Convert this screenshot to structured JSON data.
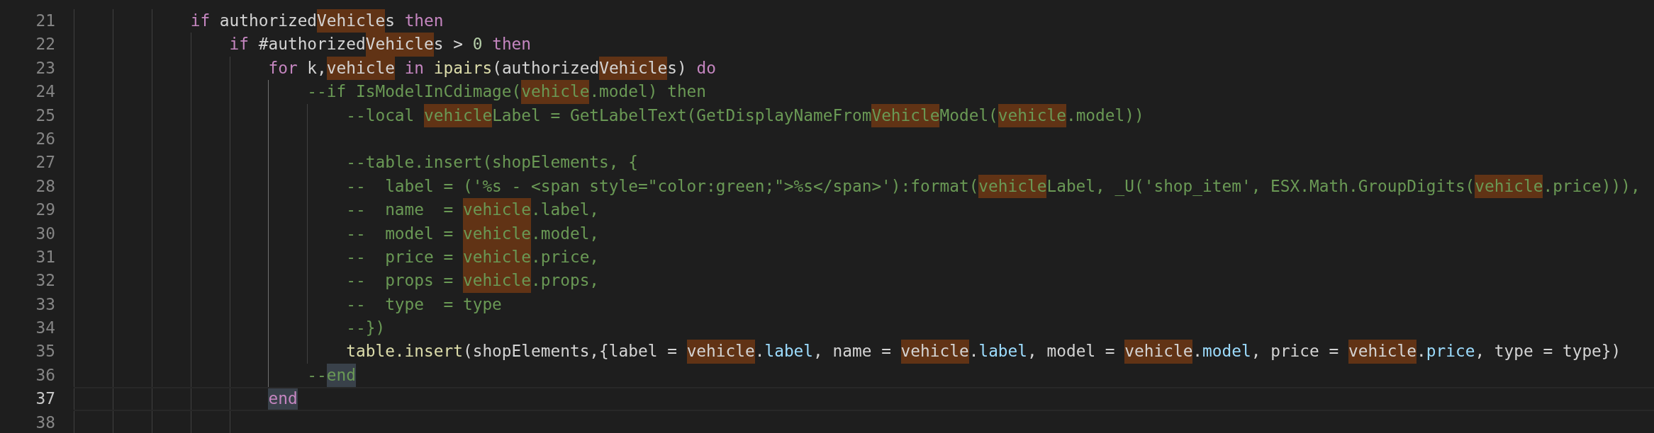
{
  "editor": {
    "lines": [
      {
        "number": "21",
        "current": false,
        "guides": [
          {
            "active": false
          },
          {
            "active": false
          },
          {
            "active": false
          }
        ],
        "tokens": [
          {
            "text": "if",
            "kind": "keyword",
            "match": false,
            "bracket_match": false
          },
          {
            "text": " authorized",
            "kind": "plain",
            "match": false,
            "bracket_match": false
          },
          {
            "text": "Vehicle",
            "kind": "plain",
            "match": true,
            "bracket_match": false
          },
          {
            "text": "s",
            "kind": "plain",
            "match": false,
            "bracket_match": false
          },
          {
            "text": " then",
            "kind": "keyword",
            "match": false,
            "bracket_match": false
          }
        ]
      },
      {
        "number": "22",
        "current": false,
        "guides": [
          {
            "active": false
          },
          {
            "active": false
          },
          {
            "active": false
          },
          {
            "active": false
          }
        ],
        "tokens": [
          {
            "text": "if",
            "kind": "keyword",
            "match": false,
            "bracket_match": false
          },
          {
            "text": " #authorized",
            "kind": "plain",
            "match": false,
            "bracket_match": false
          },
          {
            "text": "Vehicle",
            "kind": "plain",
            "match": true,
            "bracket_match": false
          },
          {
            "text": "s >",
            "kind": "plain",
            "match": false,
            "bracket_match": false
          },
          {
            "text": " 0",
            "kind": "number",
            "match": false,
            "bracket_match": false
          },
          {
            "text": " then",
            "kind": "keyword",
            "match": false,
            "bracket_match": false
          }
        ]
      },
      {
        "number": "23",
        "current": false,
        "guides": [
          {
            "active": false
          },
          {
            "active": false
          },
          {
            "active": false
          },
          {
            "active": false
          },
          {
            "active": false
          }
        ],
        "tokens": [
          {
            "text": "for",
            "kind": "keyword",
            "match": false,
            "bracket_match": false
          },
          {
            "text": " k,",
            "kind": "plain",
            "match": false,
            "bracket_match": false
          },
          {
            "text": "vehicle",
            "kind": "plain",
            "match": true,
            "bracket_match": false
          },
          {
            "text": " in",
            "kind": "keyword",
            "match": false,
            "bracket_match": false
          },
          {
            "text": " ipairs",
            "kind": "function",
            "match": false,
            "bracket_match": false
          },
          {
            "text": "(authorized",
            "kind": "plain",
            "match": false,
            "bracket_match": false
          },
          {
            "text": "Vehicle",
            "kind": "plain",
            "match": true,
            "bracket_match": false
          },
          {
            "text": "s)",
            "kind": "plain",
            "match": false,
            "bracket_match": false
          },
          {
            "text": " do",
            "kind": "keyword",
            "match": false,
            "bracket_match": false
          }
        ]
      },
      {
        "number": "24",
        "current": false,
        "guides": [
          {
            "active": false
          },
          {
            "active": false
          },
          {
            "active": false
          },
          {
            "active": false
          },
          {
            "active": false
          },
          {
            "active": true
          }
        ],
        "tokens": [
          {
            "text": "--if IsModelInCdimage(",
            "kind": "comment",
            "match": false,
            "bracket_match": false
          },
          {
            "text": "vehicle",
            "kind": "comment",
            "match": true,
            "bracket_match": false
          },
          {
            "text": ".model) then",
            "kind": "comment",
            "match": false,
            "bracket_match": false
          }
        ]
      },
      {
        "number": "25",
        "current": false,
        "guides": [
          {
            "active": false
          },
          {
            "active": false
          },
          {
            "active": false
          },
          {
            "active": false
          },
          {
            "active": false
          },
          {
            "active": true
          },
          {
            "active": false
          }
        ],
        "tokens": [
          {
            "text": "--local ",
            "kind": "comment",
            "match": false,
            "bracket_match": false
          },
          {
            "text": "vehicle",
            "kind": "comment",
            "match": true,
            "bracket_match": false
          },
          {
            "text": "Label = GetLabelText(GetDisplayNameFrom",
            "kind": "comment",
            "match": false,
            "bracket_match": false
          },
          {
            "text": "Vehicle",
            "kind": "comment",
            "match": true,
            "bracket_match": false
          },
          {
            "text": "Model(",
            "kind": "comment",
            "match": false,
            "bracket_match": false
          },
          {
            "text": "vehicle",
            "kind": "comment",
            "match": true,
            "bracket_match": false
          },
          {
            "text": ".model))",
            "kind": "comment",
            "match": false,
            "bracket_match": false
          }
        ]
      },
      {
        "number": "26",
        "current": false,
        "guides": [
          {
            "active": false
          },
          {
            "active": false
          },
          {
            "active": false
          },
          {
            "active": false
          },
          {
            "active": false
          },
          {
            "active": true
          },
          {
            "active": false
          }
        ]
      },
      {
        "number": "27",
        "current": false,
        "guides": [
          {
            "active": false
          },
          {
            "active": false
          },
          {
            "active": false
          },
          {
            "active": false
          },
          {
            "active": false
          },
          {
            "active": true
          },
          {
            "active": false
          }
        ],
        "tokens": [
          {
            "text": "--table.insert(shopElements, {",
            "kind": "comment",
            "match": false,
            "bracket_match": false
          }
        ]
      },
      {
        "number": "28",
        "current": false,
        "guides": [
          {
            "active": false
          },
          {
            "active": false
          },
          {
            "active": false
          },
          {
            "active": false
          },
          {
            "active": false
          },
          {
            "active": true
          },
          {
            "active": false
          }
        ],
        "tokens": [
          {
            "text": "--  label = ('%s - <span style=\"color:green;\">%s</span>'):format(",
            "kind": "comment",
            "match": false,
            "bracket_match": false
          },
          {
            "text": "vehicle",
            "kind": "comment",
            "match": true,
            "bracket_match": false
          },
          {
            "text": "Label, _U('shop_item', ESX.Math.GroupDigits(",
            "kind": "comment",
            "match": false,
            "bracket_match": false
          },
          {
            "text": "vehicle",
            "kind": "comment",
            "match": true,
            "bracket_match": false
          },
          {
            "text": ".price))),",
            "kind": "comment",
            "match": false,
            "bracket_match": false
          }
        ]
      },
      {
        "number": "29",
        "current": false,
        "guides": [
          {
            "active": false
          },
          {
            "active": false
          },
          {
            "active": false
          },
          {
            "active": false
          },
          {
            "active": false
          },
          {
            "active": true
          },
          {
            "active": false
          }
        ],
        "tokens": [
          {
            "text": "--  name  = ",
            "kind": "comment",
            "match": false,
            "bracket_match": false
          },
          {
            "text": "vehicle",
            "kind": "comment",
            "match": true,
            "bracket_match": false
          },
          {
            "text": ".label,",
            "kind": "comment",
            "match": false,
            "bracket_match": false
          }
        ]
      },
      {
        "number": "30",
        "current": false,
        "guides": [
          {
            "active": false
          },
          {
            "active": false
          },
          {
            "active": false
          },
          {
            "active": false
          },
          {
            "active": false
          },
          {
            "active": true
          },
          {
            "active": false
          }
        ],
        "tokens": [
          {
            "text": "--  model = ",
            "kind": "comment",
            "match": false,
            "bracket_match": false
          },
          {
            "text": "vehicle",
            "kind": "comment",
            "match": true,
            "bracket_match": false
          },
          {
            "text": ".model,",
            "kind": "comment",
            "match": false,
            "bracket_match": false
          }
        ]
      },
      {
        "number": "31",
        "current": false,
        "guides": [
          {
            "active": false
          },
          {
            "active": false
          },
          {
            "active": false
          },
          {
            "active": false
          },
          {
            "active": false
          },
          {
            "active": true
          },
          {
            "active": false
          }
        ],
        "tokens": [
          {
            "text": "--  price = ",
            "kind": "comment",
            "match": false,
            "bracket_match": false
          },
          {
            "text": "vehicle",
            "kind": "comment",
            "match": true,
            "bracket_match": false
          },
          {
            "text": ".price,",
            "kind": "comment",
            "match": false,
            "bracket_match": false
          }
        ]
      },
      {
        "number": "32",
        "current": false,
        "guides": [
          {
            "active": false
          },
          {
            "active": false
          },
          {
            "active": false
          },
          {
            "active": false
          },
          {
            "active": false
          },
          {
            "active": true
          },
          {
            "active": false
          }
        ],
        "tokens": [
          {
            "text": "--  props = ",
            "kind": "comment",
            "match": false,
            "bracket_match": false
          },
          {
            "text": "vehicle",
            "kind": "comment",
            "match": true,
            "bracket_match": false
          },
          {
            "text": ".props,",
            "kind": "comment",
            "match": false,
            "bracket_match": false
          }
        ]
      },
      {
        "number": "33",
        "current": false,
        "guides": [
          {
            "active": false
          },
          {
            "active": false
          },
          {
            "active": false
          },
          {
            "active": false
          },
          {
            "active": false
          },
          {
            "active": true
          },
          {
            "active": false
          }
        ],
        "tokens": [
          {
            "text": "--  type  = type",
            "kind": "comment",
            "match": false,
            "bracket_match": false
          }
        ]
      },
      {
        "number": "34",
        "current": false,
        "guides": [
          {
            "active": false
          },
          {
            "active": false
          },
          {
            "active": false
          },
          {
            "active": false
          },
          {
            "active": false
          },
          {
            "active": true
          },
          {
            "active": false
          }
        ],
        "tokens": [
          {
            "text": "--})",
            "kind": "comment",
            "match": false,
            "bracket_match": false
          }
        ]
      },
      {
        "number": "35",
        "current": false,
        "guides": [
          {
            "active": false
          },
          {
            "active": false
          },
          {
            "active": false
          },
          {
            "active": false
          },
          {
            "active": false
          },
          {
            "active": true
          },
          {
            "active": false
          }
        ],
        "tokens": [
          {
            "text": "table.insert",
            "kind": "function",
            "match": false,
            "bracket_match": false
          },
          {
            "text": "(shopElements,{label = ",
            "kind": "plain",
            "match": false,
            "bracket_match": false
          },
          {
            "text": "vehicle",
            "kind": "plain",
            "match": true,
            "bracket_match": false
          },
          {
            "text": ".",
            "kind": "plain",
            "match": false,
            "bracket_match": false
          },
          {
            "text": "label",
            "kind": "property",
            "match": false,
            "bracket_match": false
          },
          {
            "text": ", name = ",
            "kind": "plain",
            "match": false,
            "bracket_match": false
          },
          {
            "text": "vehicle",
            "kind": "plain",
            "match": true,
            "bracket_match": false
          },
          {
            "text": ".",
            "kind": "plain",
            "match": false,
            "bracket_match": false
          },
          {
            "text": "label",
            "kind": "property",
            "match": false,
            "bracket_match": false
          },
          {
            "text": ", model = ",
            "kind": "plain",
            "match": false,
            "bracket_match": false
          },
          {
            "text": "vehicle",
            "kind": "plain",
            "match": true,
            "bracket_match": false
          },
          {
            "text": ".",
            "kind": "plain",
            "match": false,
            "bracket_match": false
          },
          {
            "text": "model",
            "kind": "property",
            "match": false,
            "bracket_match": false
          },
          {
            "text": ", price = ",
            "kind": "plain",
            "match": false,
            "bracket_match": false
          },
          {
            "text": "vehicle",
            "kind": "plain",
            "match": true,
            "bracket_match": false
          },
          {
            "text": ".",
            "kind": "plain",
            "match": false,
            "bracket_match": false
          },
          {
            "text": "price",
            "kind": "property",
            "match": false,
            "bracket_match": false
          },
          {
            "text": ", type = type})",
            "kind": "plain",
            "match": false,
            "bracket_match": false
          }
        ]
      },
      {
        "number": "36",
        "current": false,
        "guides": [
          {
            "active": false
          },
          {
            "active": false
          },
          {
            "active": false
          },
          {
            "active": false
          },
          {
            "active": false
          },
          {
            "active": true
          }
        ],
        "tokens": [
          {
            "text": "--",
            "kind": "comment",
            "match": false,
            "bracket_match": false
          },
          {
            "text": "end",
            "kind": "comment",
            "match": false,
            "bracket_match": true
          }
        ]
      },
      {
        "number": "37",
        "current": true,
        "guides": [
          {
            "active": false
          },
          {
            "active": false
          },
          {
            "active": false
          },
          {
            "active": false
          },
          {
            "active": false
          }
        ],
        "tokens": [
          {
            "text": "end",
            "kind": "keyword",
            "match": false,
            "bracket_match": true
          }
        ]
      },
      {
        "number": "38",
        "current": false,
        "guides": [
          {
            "active": false
          },
          {
            "active": false
          },
          {
            "active": false
          },
          {
            "active": false
          },
          {
            "active": false
          }
        ]
      }
    ]
  }
}
